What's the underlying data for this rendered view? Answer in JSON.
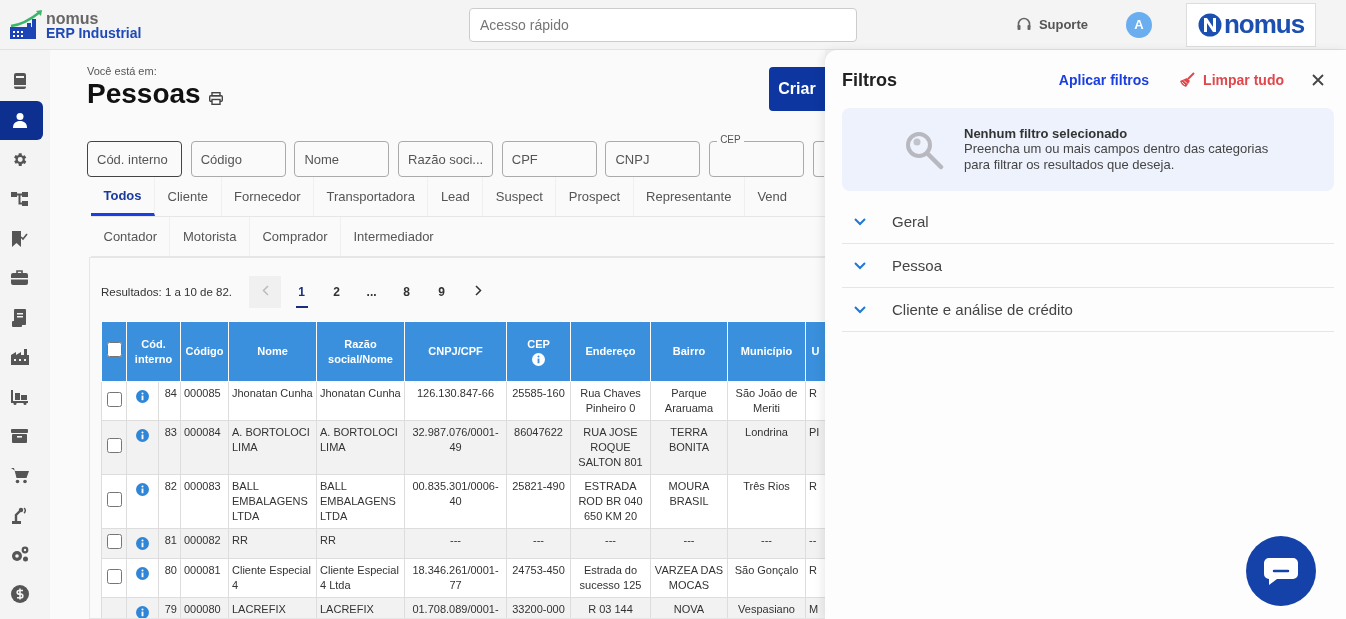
{
  "header": {
    "logo": {
      "brand": "nomus",
      "product": "ERP Industrial"
    },
    "search": {
      "placeholder": "Acesso rápido"
    },
    "support": "Suporte",
    "avatar": "A",
    "partner_logo": "nomus"
  },
  "sidebar": {
    "items": [
      {
        "selected": false
      },
      {
        "selected": true
      },
      {
        "selected": false
      },
      {
        "selected": false
      },
      {
        "selected": false
      },
      {
        "selected": false
      },
      {
        "selected": false
      },
      {
        "selected": false
      },
      {
        "selected": false
      },
      {
        "selected": false
      },
      {
        "selected": false
      },
      {
        "selected": false
      },
      {
        "selected": false
      },
      {
        "selected": false
      }
    ]
  },
  "page": {
    "breadcrumb": "Você está em:",
    "title": "Pessoas",
    "create_button": "Criar"
  },
  "filter_fields": [
    {
      "placeholder": "Cód. interno",
      "focused": true
    },
    {
      "placeholder": "Código",
      "focused": false
    },
    {
      "placeholder": "Nome",
      "focused": false
    },
    {
      "placeholder": "Razão soci...",
      "focused": false
    },
    {
      "placeholder": "CPF",
      "focused": false
    },
    {
      "placeholder": "CNPJ",
      "focused": false
    },
    {
      "label": "CEP",
      "focused": false
    },
    {
      "focused": false
    }
  ],
  "tab_rows": [
    {
      "tabs": [
        {
          "label": "Todos",
          "selected": true
        },
        {
          "label": "Cliente",
          "selected": false
        },
        {
          "label": "Fornecedor",
          "selected": false
        },
        {
          "label": "Transportadora",
          "selected": false
        },
        {
          "label": "Lead",
          "selected": false
        },
        {
          "label": "Suspect",
          "selected": false
        },
        {
          "label": "Prospect",
          "selected": false
        },
        {
          "label": "Representante",
          "selected": false
        },
        {
          "label": "Vend",
          "selected": false
        }
      ]
    },
    {
      "tabs": [
        {
          "label": "Contador",
          "selected": false
        },
        {
          "label": "Motorista",
          "selected": false
        },
        {
          "label": "Comprador",
          "selected": false
        },
        {
          "label": "Intermediador",
          "selected": false
        }
      ]
    }
  ],
  "results": {
    "summary": "Resultados: 1 a 10 de 82.",
    "prev_disabled": true,
    "next_disabled": false,
    "pages": [
      {
        "label": "1",
        "selected": true
      },
      {
        "label": "2",
        "selected": false
      },
      {
        "label": "...",
        "selected": false
      },
      {
        "label": "8",
        "selected": false
      },
      {
        "label": "9",
        "selected": false
      }
    ]
  },
  "table": {
    "select_all": {
      "checked": false
    },
    "columns": [
      {
        "label": "Cód. interno",
        "info": false
      },
      {
        "label": "Código",
        "info": false
      },
      {
        "label": "Nome",
        "info": false
      },
      {
        "label": "Razão social/Nome",
        "info": false
      },
      {
        "label": "CNPJ/CPF",
        "info": false
      },
      {
        "label": "CEP",
        "info": true
      },
      {
        "label": "Endereço",
        "info": false
      },
      {
        "label": "Bairro",
        "info": false
      },
      {
        "label": "Município",
        "info": false
      },
      {
        "label": "U",
        "info": false
      }
    ],
    "rows": [
      {
        "checked": false,
        "cells": [
          "84",
          "000085",
          "Jhonatan Cunha",
          "Jhonatan Cunha",
          "126.130.847-66",
          "25585-160",
          "Rua Chaves Pinheiro 0",
          "Parque Araruama",
          "São João de Meriti",
          "R"
        ]
      },
      {
        "checked": false,
        "cells": [
          "83",
          "000084",
          "A. BORTOLOCI LIMA",
          "A. BORTOLOCI LIMA",
          "32.987.076/0001-49",
          "86047622",
          "RUA JOSE ROQUE SALTON 801",
          "TERRA BONITA",
          "Londrina",
          "PI"
        ]
      },
      {
        "checked": false,
        "cells": [
          "82",
          "000083",
          "BALL EMBALAGENS LTDA",
          "BALL EMBALAGENS LTDA",
          "00.835.301/0006-40",
          "25821-490",
          "ESTRADA ROD BR 040 650 KM 20",
          "MOURA BRASIL",
          "Três Rios",
          "R"
        ]
      },
      {
        "checked": false,
        "cells": [
          "81",
          "000082",
          "RR",
          "RR",
          "---",
          "---",
          "---",
          "---",
          "---",
          "--"
        ]
      },
      {
        "checked": false,
        "cells": [
          "80",
          "000081",
          "Cliente Especial 4",
          "Cliente Especial 4 Ltda",
          "18.346.261/0001-77",
          "24753-450",
          "Estrada do sucesso 125",
          "VARZEA DAS MOCAS",
          "São Gonçalo",
          "R"
        ]
      },
      {
        "cells": [
          "79",
          "000080",
          "LACREFIX",
          "LACREFIX",
          "01.708.089/0001-",
          "33200-000",
          "R 03 144",
          "NOVA",
          "Vespasiano",
          "M"
        ]
      }
    ]
  },
  "filters_panel": {
    "title": "Filtros",
    "apply": "Aplicar filtros",
    "clear": "Limpar tudo",
    "empty_title": "Nenhum filtro selecionado",
    "empty_text": "Preencha um ou mais campos dentro das categorias para filtrar os resultados que deseja.",
    "sections": [
      {
        "label": "Geral",
        "expanded": false
      },
      {
        "label": "Pessoa",
        "expanded": false
      },
      {
        "label": "Cliente e análise de crédito",
        "expanded": false
      }
    ]
  }
}
